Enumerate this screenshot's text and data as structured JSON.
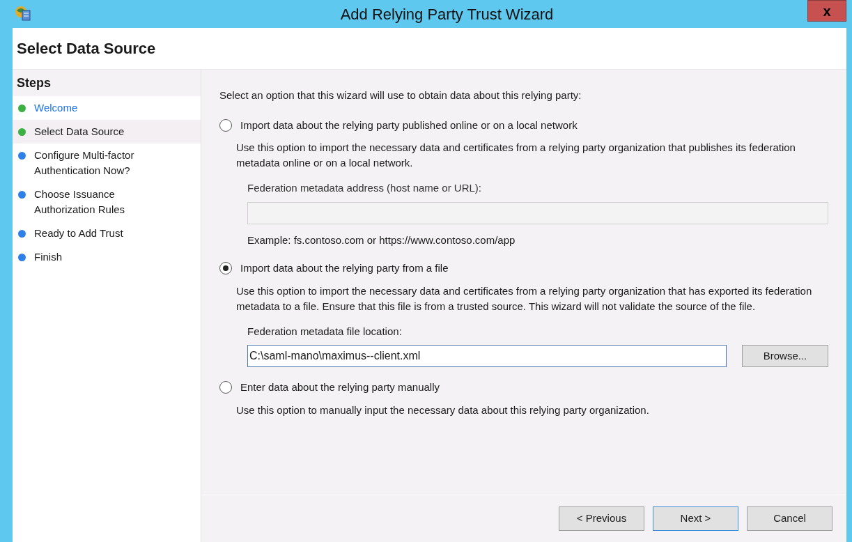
{
  "window": {
    "title": "Add Relying Party Trust Wizard",
    "close": "x"
  },
  "page_title": "Select Data Source",
  "steps": {
    "heading": "Steps",
    "items": [
      {
        "label": "Welcome",
        "complete": true,
        "link": true,
        "selected": false
      },
      {
        "label": "Select Data Source",
        "complete": true,
        "link": false,
        "selected": true
      },
      {
        "label": "Configure Multi-factor Authentication Now?",
        "complete": false,
        "link": false,
        "selected": false
      },
      {
        "label": "Choose Issuance Authorization Rules",
        "complete": false,
        "link": false,
        "selected": false
      },
      {
        "label": "Ready to Add Trust",
        "complete": false,
        "link": false,
        "selected": false
      },
      {
        "label": "Finish",
        "complete": false,
        "link": false,
        "selected": false
      }
    ]
  },
  "intro": "Select an option that this wizard will use to obtain data about this relying party:",
  "options": [
    {
      "label": "Import data about the relying party published online or on a local network",
      "selected": false,
      "description": "Use this option to import the necessary data and certificates from a relying party organization that publishes its federation metadata online or on a local network.",
      "field": {
        "label": "Federation metadata address (host name or URL):",
        "disabled": true
      },
      "example": "Example: fs.contoso.com or https://www.contoso.com/app"
    },
    {
      "label": "Import data about the relying party from a file",
      "selected": true,
      "description": "Use this option to import the necessary data and certificates from a relying party organization that has exported its federation metadata to a file. Ensure that this file is from a trusted source.  This wizard will not validate the source of the file.",
      "field": {
        "label": "Federation metadata file location:",
        "value": "C:\\saml-mano\\maximus--client.xml",
        "disabled": false,
        "button": "Browse..."
      }
    },
    {
      "label": "Enter data about the relying party manually",
      "selected": false,
      "description": "Use this option to manually input the necessary data about this relying party organization."
    }
  ],
  "buttons": [
    {
      "label": "< Previous",
      "default": false
    },
    {
      "label": "Next >",
      "default": true
    },
    {
      "label": "Cancel",
      "default": false
    }
  ]
}
